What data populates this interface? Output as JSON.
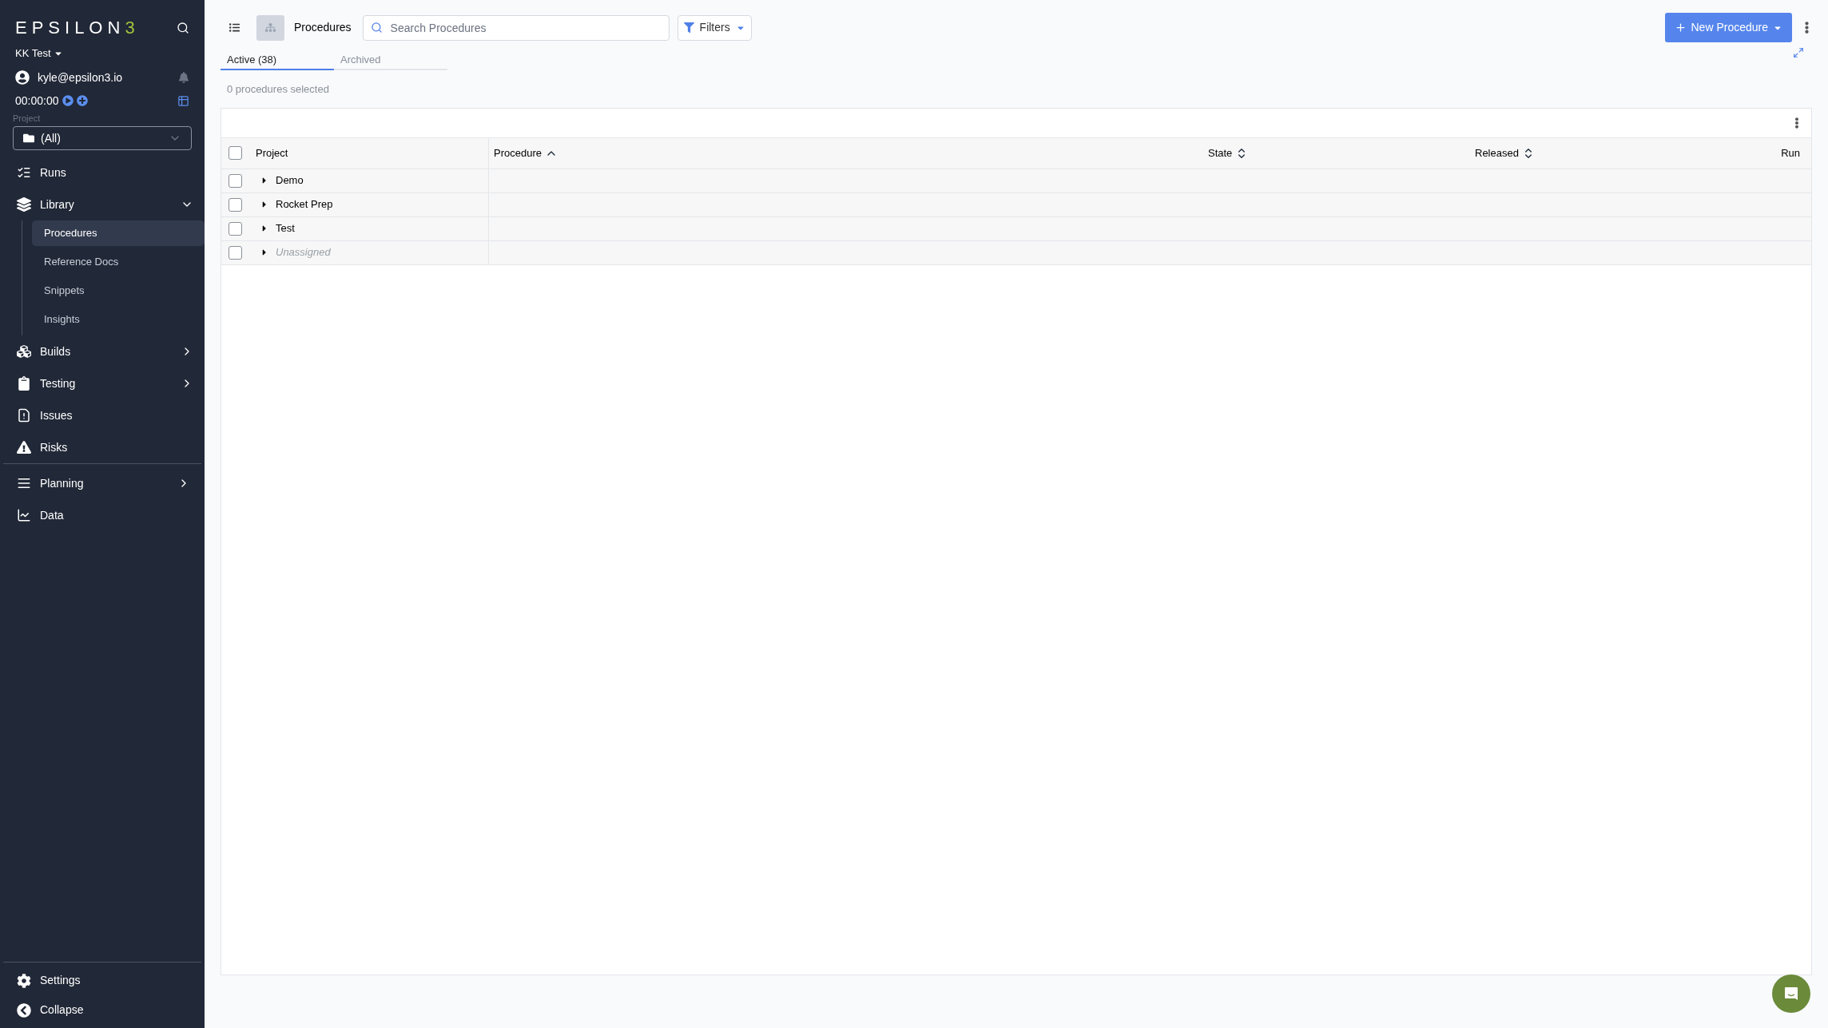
{
  "sidebar": {
    "logo": "EPSILON3",
    "workspace": "KK Test",
    "user": "kyle@epsilon3.io",
    "timer": "00:00:00",
    "project_label": "Project",
    "project_value": "(All)",
    "nav_sections": [
      [
        {
          "label": "Runs",
          "kind": "link"
        },
        {
          "label": "Library",
          "kind": "group",
          "expanded": true,
          "children": [
            {
              "label": "Procedures",
              "selected": true
            },
            {
              "label": "Reference Docs",
              "selected": false
            },
            {
              "label": "Snippets",
              "selected": false
            },
            {
              "label": "Insights",
              "selected": false
            }
          ]
        },
        {
          "label": "Builds",
          "kind": "group",
          "expanded": false
        },
        {
          "label": "Testing",
          "kind": "group",
          "expanded": false
        },
        {
          "label": "Issues",
          "kind": "link"
        },
        {
          "label": "Risks",
          "kind": "link"
        }
      ],
      [
        {
          "label": "Planning",
          "kind": "group",
          "expanded": false
        },
        {
          "label": "Data",
          "kind": "link"
        }
      ]
    ],
    "footer": [
      {
        "label": "Settings"
      },
      {
        "label": "Collapse"
      }
    ]
  },
  "toolbar": {
    "view_toggle": [
      {
        "selected": false
      },
      {
        "selected": true
      }
    ],
    "title": "Procedures",
    "search": {
      "placeholder": "Search Procedures"
    },
    "filters": "Filters",
    "new_button": "New Procedure"
  },
  "tabs": [
    {
      "label": "Active (38)",
      "selected": true
    },
    {
      "label": "Archived",
      "selected": false
    }
  ],
  "selection_count": "0 procedures selected",
  "table": {
    "all_checked": false,
    "columns": [
      {
        "label": "Project",
        "kind": "plain"
      },
      {
        "label": "Procedure",
        "kind": "sorted"
      },
      {
        "label": "State",
        "kind": "sortable"
      },
      {
        "label": "Released",
        "kind": "sortable"
      },
      {
        "label": "Run",
        "kind": "plain"
      }
    ],
    "rows": [
      {
        "project": "Demo",
        "checked": false,
        "unassigned": false
      },
      {
        "project": "Rocket Prep",
        "checked": false,
        "unassigned": false
      },
      {
        "project": "Test",
        "checked": false,
        "unassigned": false
      },
      {
        "project": "Unassigned",
        "checked": false,
        "unassigned": true
      }
    ]
  }
}
